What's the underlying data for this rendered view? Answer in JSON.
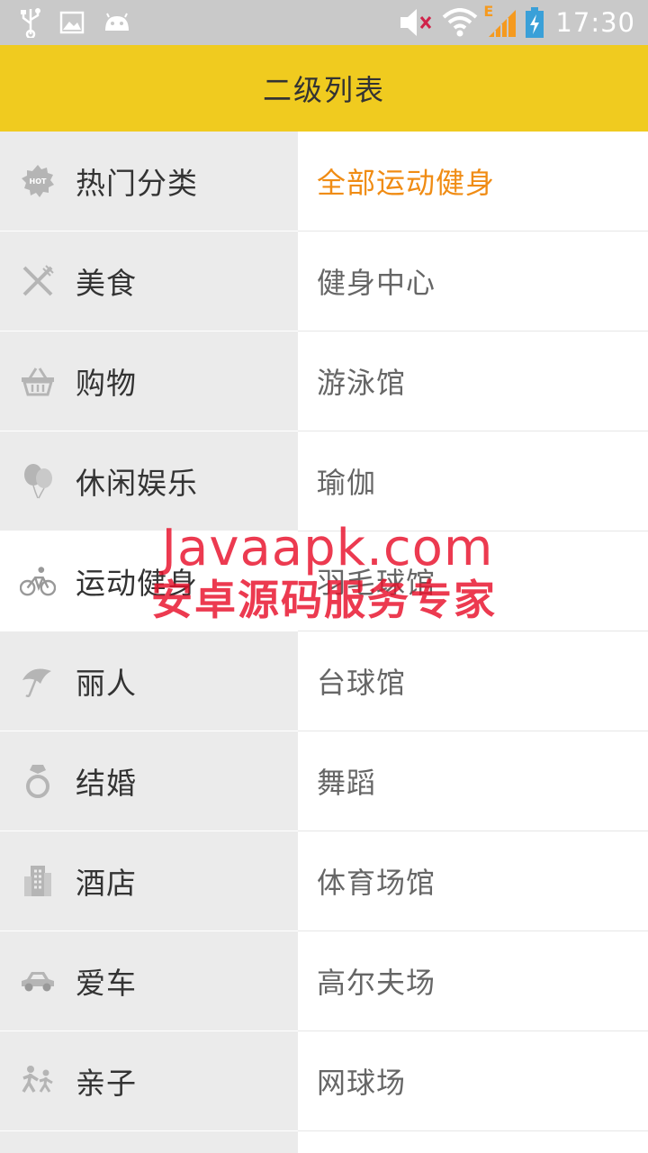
{
  "status_bar": {
    "time": "17:30",
    "network_badge": "E",
    "icons": [
      "usb-icon",
      "gallery-icon",
      "android-icon",
      "mute-icon",
      "wifi-icon",
      "signal-icon",
      "battery-charging-icon"
    ]
  },
  "title_bar": {
    "title": "二级列表"
  },
  "categories": [
    {
      "label": "热门分类",
      "icon": "hot-icon",
      "selected": false
    },
    {
      "label": "美食",
      "icon": "fork-knife-icon",
      "selected": false
    },
    {
      "label": "购物",
      "icon": "basket-icon",
      "selected": false
    },
    {
      "label": "休闲娱乐",
      "icon": "balloon-icon",
      "selected": false
    },
    {
      "label": "运动健身",
      "icon": "bicycle-icon",
      "selected": true
    },
    {
      "label": "丽人",
      "icon": "umbrella-icon",
      "selected": false
    },
    {
      "label": "结婚",
      "icon": "ring-icon",
      "selected": false
    },
    {
      "label": "酒店",
      "icon": "building-icon",
      "selected": false
    },
    {
      "label": "爱车",
      "icon": "car-icon",
      "selected": false
    },
    {
      "label": "亲子",
      "icon": "family-icon",
      "selected": false
    }
  ],
  "subcategories": [
    {
      "label": "全部运动健身",
      "active": true
    },
    {
      "label": "健身中心",
      "active": false
    },
    {
      "label": "游泳馆",
      "active": false
    },
    {
      "label": "瑜伽",
      "active": false
    },
    {
      "label": "羽毛球馆",
      "active": false
    },
    {
      "label": "台球馆",
      "active": false
    },
    {
      "label": "舞蹈",
      "active": false
    },
    {
      "label": "体育场馆",
      "active": false
    },
    {
      "label": "高尔夫场",
      "active": false
    },
    {
      "label": "网球场",
      "active": false
    }
  ],
  "watermark": {
    "line1": "Javaapk.com",
    "line2": "安卓源码服务专家"
  },
  "colors": {
    "title_bar": "#f0cb1f",
    "status_bar": "#c9c9c9",
    "left_bg": "#ebebeb",
    "active_text": "#f08c14",
    "watermark": "#e8102a"
  }
}
